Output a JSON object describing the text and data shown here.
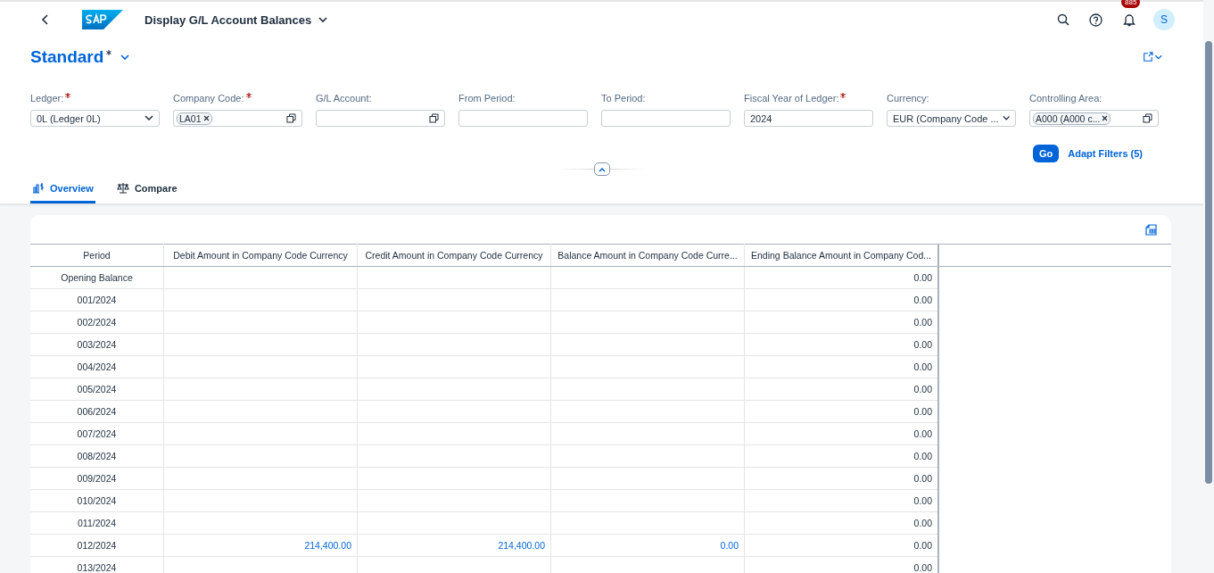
{
  "shell": {
    "title": "Display G/L Account Balances",
    "notification_count": "885",
    "avatar": "S"
  },
  "variant": {
    "name": "Standard",
    "modified": true
  },
  "filters": [
    {
      "label": "Ledger:",
      "required": true,
      "kind": "select",
      "value": "0L (Ledger 0L)"
    },
    {
      "label": "Company Code:",
      "required": true,
      "kind": "token",
      "token": "LA01"
    },
    {
      "label": "G/L Account:",
      "required": false,
      "kind": "valuehelp"
    },
    {
      "label": "From Period:",
      "required": false,
      "kind": "input"
    },
    {
      "label": "To Period:",
      "required": false,
      "kind": "input"
    },
    {
      "label": "Fiscal Year of Ledger:",
      "required": true,
      "kind": "input",
      "value": "2024"
    },
    {
      "label": "Currency:",
      "required": false,
      "kind": "select",
      "value": "EUR (Company Code ..."
    },
    {
      "label": "Controlling Area:",
      "required": false,
      "kind": "token",
      "token": "A000 (A000 c..."
    }
  ],
  "actions": {
    "go": "Go",
    "adapt": "Adapt Filters (5)"
  },
  "tabs": [
    {
      "label": "Overview",
      "selected": true,
      "kind": "overview"
    },
    {
      "label": "Compare",
      "selected": false,
      "kind": "compare"
    }
  ],
  "table": {
    "columns": [
      "Period",
      "Debit Amount in Company Code Currency",
      "Credit Amount in Company Code Currency",
      "Balance Amount in Company Code Curre...",
      "Ending Balance Amount in Company Cod..."
    ],
    "rows": [
      {
        "period": "Opening Balance",
        "ending": "0.00"
      },
      {
        "period": "001/2024",
        "ending": "0.00"
      },
      {
        "period": "002/2024",
        "ending": "0.00"
      },
      {
        "period": "003/2024",
        "ending": "0.00"
      },
      {
        "period": "004/2024",
        "ending": "0.00"
      },
      {
        "period": "005/2024",
        "ending": "0.00"
      },
      {
        "period": "006/2024",
        "ending": "0.00"
      },
      {
        "period": "007/2024",
        "ending": "0.00"
      },
      {
        "period": "008/2024",
        "ending": "0.00"
      },
      {
        "period": "009/2024",
        "ending": "0.00"
      },
      {
        "period": "010/2024",
        "ending": "0.00"
      },
      {
        "period": "011/2024",
        "ending": "0.00"
      },
      {
        "period": "012/2024",
        "debit": "214,400.00",
        "credit": "214,400.00",
        "balance": "0.00",
        "ending": "0.00"
      },
      {
        "period": "013/2024",
        "ending": "0.00"
      }
    ]
  }
}
